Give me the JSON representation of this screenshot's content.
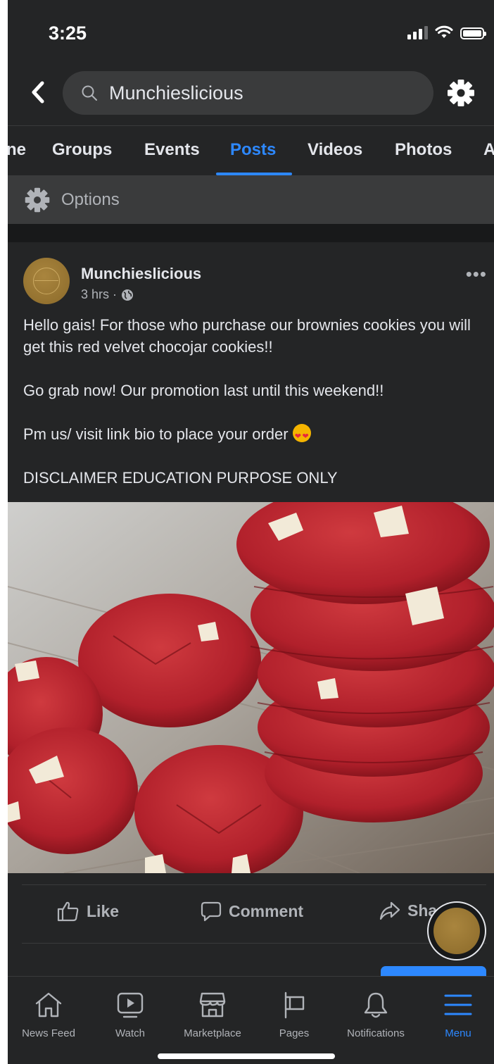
{
  "status_bar": {
    "time": "3:25"
  },
  "search": {
    "query": "Munchieslicious"
  },
  "tabs": [
    "ne",
    "Groups",
    "Events",
    "Posts",
    "Videos",
    "Photos",
    "A"
  ],
  "active_tab": "Posts",
  "options": {
    "label": "Options"
  },
  "post": {
    "author": "Munchieslicious",
    "time": "3 hrs · ",
    "paragraphs": [
      "Hello gais! For those who purchase our brownies cookies you will get this red velvet chocojar cookies!!",
      "Go grab now! Our promotion last until this weekend!!",
      "Pm us/ visit link bio to place your order ",
      "DISCLAIMER EDUCATION PURPOSE ONLY"
    ],
    "image_subject": "red velvet cookies",
    "actions": {
      "like": "Like",
      "comment": "Comment",
      "share": "Sha"
    }
  },
  "bottom_nav": [
    {
      "label": "News Feed",
      "icon": "home-icon"
    },
    {
      "label": "Watch",
      "icon": "watch-icon"
    },
    {
      "label": "Marketplace",
      "icon": "marketplace-icon"
    },
    {
      "label": "Pages",
      "icon": "flag-icon"
    },
    {
      "label": "Notifications",
      "icon": "bell-icon"
    },
    {
      "label": "Menu",
      "icon": "menu-icon",
      "active": true
    }
  ],
  "colors": {
    "accent": "#2d88ff",
    "background": "#242526",
    "surface": "#3a3b3c",
    "cookie": "#b3202b"
  }
}
